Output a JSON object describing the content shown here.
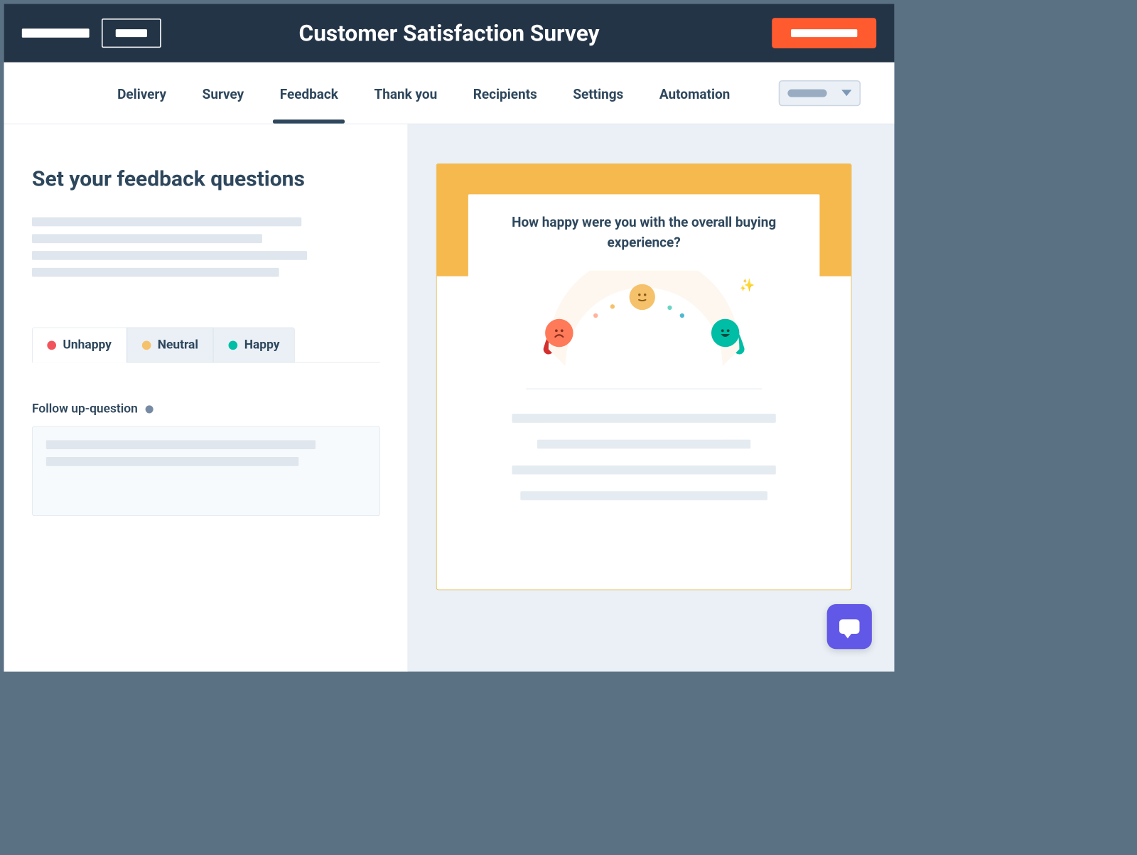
{
  "header": {
    "title": "Customer Satisfaction Survey"
  },
  "tabs": [
    {
      "label": "Delivery"
    },
    {
      "label": "Survey"
    },
    {
      "label": "Feedback",
      "active": true
    },
    {
      "label": "Thank you"
    },
    {
      "label": "Recipients"
    },
    {
      "label": "Settings"
    },
    {
      "label": "Automation"
    }
  ],
  "left": {
    "heading": "Set your feedback questions",
    "sentiment_tabs": [
      {
        "label": "Unhappy",
        "color": "red",
        "active": true
      },
      {
        "label": "Neutral",
        "color": "yellow"
      },
      {
        "label": "Happy",
        "color": "green"
      }
    ],
    "follow_up_label": "Follow up-question"
  },
  "preview": {
    "question": "How happy were you with the overall buying experience?"
  },
  "colors": {
    "header_bg": "#243447",
    "cta_bg": "#ff5b2e",
    "preview_banner": "#f5b94e",
    "widget_bg": "#6258e8",
    "arc_red": "#d32f2f",
    "arc_orange": "#ff7a59",
    "arc_yellow": "#f5c26b",
    "arc_teal": "#4fb9d1",
    "arc_green": "#00bda5"
  }
}
